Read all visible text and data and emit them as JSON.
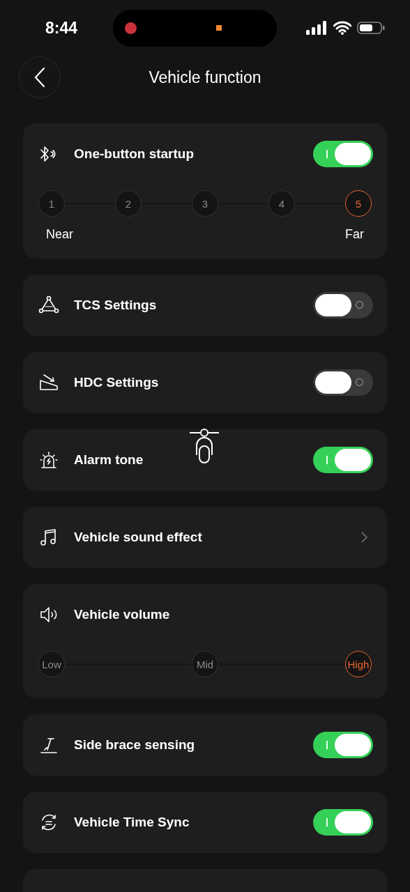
{
  "status_bar": {
    "time": "8:44"
  },
  "header": {
    "title": "Vehicle function"
  },
  "cards": [
    {
      "kind": "toggle",
      "label": "One-button startup",
      "on": true,
      "steps": {
        "options": [
          {
            "label": "1",
            "selected": false
          },
          {
            "label": "2",
            "selected": false
          },
          {
            "label": "3",
            "selected": false
          },
          {
            "label": "4",
            "selected": false
          },
          {
            "label": "5",
            "selected": true
          }
        ],
        "ends": [
          "Near",
          "Far"
        ]
      }
    },
    {
      "kind": "toggle",
      "label": "TCS Settings",
      "on": false
    },
    {
      "kind": "toggle",
      "label": "HDC Settings",
      "on": false
    },
    {
      "kind": "toggle",
      "label": "Alarm tone",
      "on": true
    },
    {
      "kind": "link",
      "label": "Vehicle sound effect"
    },
    {
      "kind": "plain",
      "label": "Vehicle volume",
      "steps": {
        "options": [
          {
            "label": "Low",
            "selected": false
          },
          {
            "label": "Mid",
            "selected": false
          },
          {
            "label": "High",
            "selected": true
          }
        ]
      }
    },
    {
      "kind": "toggle",
      "label": "Side brace sensing",
      "on": true
    },
    {
      "kind": "toggle",
      "label": "Vehicle Time Sync",
      "on": true
    }
  ]
}
